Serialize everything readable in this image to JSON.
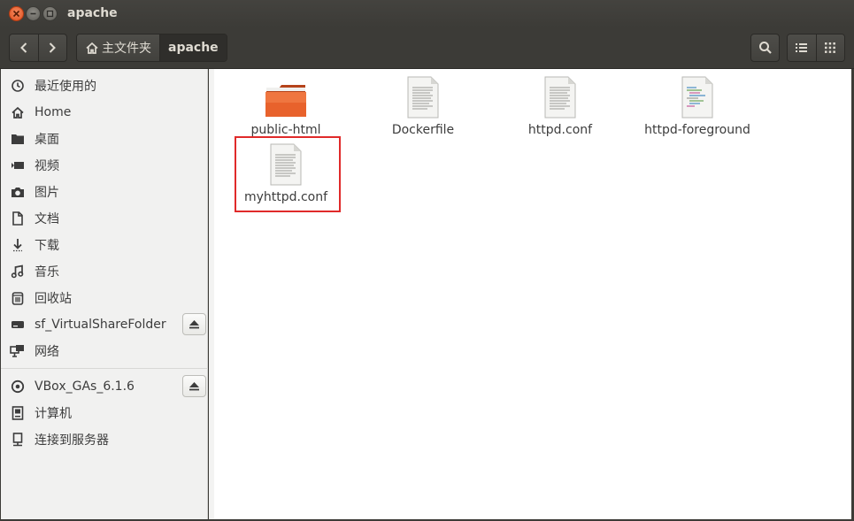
{
  "window": {
    "title": "apache"
  },
  "toolbar": {
    "back_icon": "chevron-left-icon",
    "forward_icon": "chevron-right-icon",
    "breadcrumb": [
      {
        "label": "主文件夹",
        "icon": "home-icon"
      },
      {
        "label": "apache",
        "current": true
      }
    ],
    "search_icon": "search-icon",
    "list_view_icon": "list-view-icon",
    "grid_view_icon": "grid-view-icon"
  },
  "sidebar": {
    "places": [
      {
        "label": "最近使用的",
        "icon": "recent-clock-icon"
      },
      {
        "label": "Home",
        "icon": "home-icon"
      },
      {
        "label": "桌面",
        "icon": "desktop-folder-icon"
      },
      {
        "label": "视频",
        "icon": "video-icon"
      },
      {
        "label": "图片",
        "icon": "camera-icon"
      },
      {
        "label": "文档",
        "icon": "document-icon"
      },
      {
        "label": "下载",
        "icon": "download-icon"
      },
      {
        "label": "音乐",
        "icon": "music-icon"
      },
      {
        "label": "回收站",
        "icon": "trash-icon"
      },
      {
        "label": "sf_VirtualShareFolder",
        "icon": "drive-icon",
        "ejectable": true
      },
      {
        "label": "网络",
        "icon": "network-icon"
      }
    ],
    "devices": [
      {
        "label": "VBox_GAs_6.1.6",
        "icon": "optical-disc-icon",
        "ejectable": true
      },
      {
        "label": "计算机",
        "icon": "computer-icon"
      },
      {
        "label": "连接到服务器",
        "icon": "server-icon"
      }
    ]
  },
  "files": [
    {
      "name": "public-html",
      "type": "folder"
    },
    {
      "name": "Dockerfile",
      "type": "text"
    },
    {
      "name": "httpd.conf",
      "type": "text"
    },
    {
      "name": "httpd-foreground",
      "type": "script"
    },
    {
      "name": "myhttpd.conf",
      "type": "text",
      "highlighted": true
    }
  ],
  "colors": {
    "highlight_border": "#e02a2a",
    "folder_orange": "#e8622c",
    "titlebar_bg": "#3c3b37"
  }
}
